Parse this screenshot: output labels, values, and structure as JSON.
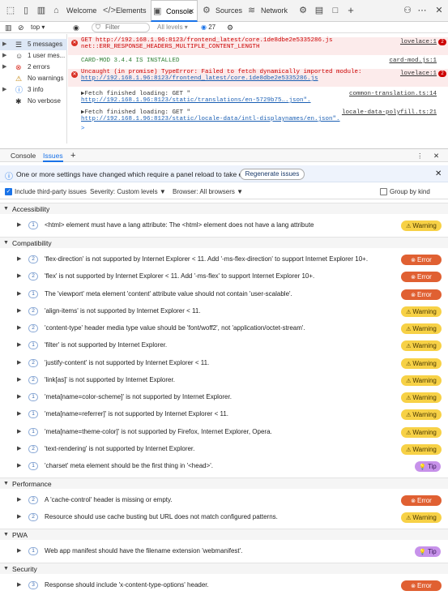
{
  "tabs": {
    "welcome": "Welcome",
    "elements": "Elements",
    "console": "Console",
    "sources": "Sources",
    "network": "Network",
    "new_tab": "+"
  },
  "toolbar": {
    "context": "top",
    "filter_placeholder": "Filter",
    "levels": "All levels",
    "issue_count": "27"
  },
  "sidebar": {
    "items": [
      {
        "label": "5 messages",
        "icon": "list-icon"
      },
      {
        "label": "1 user mes...",
        "icon": "user-icon"
      },
      {
        "label": "2 errors",
        "icon": "error-icon"
      },
      {
        "label": "No warnings",
        "icon": "warning-icon"
      },
      {
        "label": "3 info",
        "icon": "info-icon"
      },
      {
        "label": "No verbose",
        "icon": "verbose-icon"
      }
    ]
  },
  "console": {
    "msg1_line1": "GET http://192.168.1.96:8123/frontend_latest/core.1de8dbe2e5335286.js",
    "msg1_line2": "net::ERR_RESPONSE_HEADERS_MULTIPLE_CONTENT_LENGTH",
    "msg1_src": "lovelace:1",
    "msg2": "CARD-MOD 3.4.4 IS INSTALLED",
    "msg2_src": "card-mod.js:1",
    "msg3_line1": "Uncaught (in promise) TypeError: Failed to fetch dynamically imported module:",
    "msg3_line2": "http://192.168.1.96:8123/frontend_latest/core.1de8dbe2e5335286.js",
    "msg3_src": "lovelace:1",
    "msg4_line1": "▶Fetch finished loading: GET \"",
    "msg4_line2": "http://192.168.1.96:8123/static/translations/en-5729b75….json\".",
    "msg4_src": "common-translation.ts:14",
    "msg5_line1": "▶Fetch finished loading: GET \"",
    "msg5_line2": "http://192.168.1.96:8123/static/locale-data/intl-displaynames/en.json\".",
    "msg5_src": "locale-data-polyfill.ts:21",
    "count": "2",
    "prompt": ">"
  },
  "drawer": {
    "tab_console": "Console",
    "tab_issues": "Issues",
    "add": "+"
  },
  "infobar": {
    "text": "One or more settings have changed which require a panel reload to take effect.",
    "button": "Regenerate issues"
  },
  "options": {
    "third_party": "Include third-party issues",
    "severity": "Severity: Custom levels",
    "browser": "Browser: All browsers",
    "group": "Group by kind"
  },
  "categories": [
    {
      "name": "Accessibility",
      "issues": [
        {
          "count": "1",
          "text": "<html> element must have a lang attribute: The <html> element does not have a lang attribute",
          "severity": "Warning"
        }
      ]
    },
    {
      "name": "Compatibility",
      "issues": [
        {
          "count": "2",
          "text": "'flex-direction' is not supported by Internet Explorer < 11. Add '-ms-flex-direction' to support Internet Explorer 10+.",
          "severity": "Error"
        },
        {
          "count": "2",
          "text": "'flex' is not supported by Internet Explorer < 11. Add '-ms-flex' to support Internet Explorer 10+.",
          "severity": "Error"
        },
        {
          "count": "1",
          "text": "The 'viewport' meta element 'content' attribute value should not contain 'user-scalable'.",
          "severity": "Error"
        },
        {
          "count": "2",
          "text": "'align-items' is not supported by Internet Explorer < 11.",
          "severity": "Warning"
        },
        {
          "count": "2",
          "text": "'content-type' header media type value should be 'font/woff2', not 'application/octet-stream'.",
          "severity": "Warning"
        },
        {
          "count": "1",
          "text": "'filter' is not supported by Internet Explorer.",
          "severity": "Warning"
        },
        {
          "count": "2",
          "text": "'justify-content' is not supported by Internet Explorer < 11.",
          "severity": "Warning"
        },
        {
          "count": "2",
          "text": "'link[as]' is not supported by Internet Explorer.",
          "severity": "Warning"
        },
        {
          "count": "1",
          "text": "'meta[name=color-scheme]' is not supported by Internet Explorer.",
          "severity": "Warning"
        },
        {
          "count": "1",
          "text": "'meta[name=referrer]' is not supported by Internet Explorer < 11.",
          "severity": "Warning"
        },
        {
          "count": "1",
          "text": "'meta[name=theme-color]' is not supported by Firefox, Internet Explorer, Opera.",
          "severity": "Warning"
        },
        {
          "count": "2",
          "text": "'text-rendering' is not supported by Internet Explorer.",
          "severity": "Warning"
        },
        {
          "count": "1",
          "text": "'charset' meta element should be the first thing in '<head>'.",
          "severity": "Tip"
        }
      ]
    },
    {
      "name": "Performance",
      "issues": [
        {
          "count": "2",
          "text": "A 'cache-control' header is missing or empty.",
          "severity": "Error"
        },
        {
          "count": "2",
          "text": "Resource should use cache busting but URL does not match configured patterns.",
          "severity": "Warning"
        }
      ]
    },
    {
      "name": "PWA",
      "issues": [
        {
          "count": "1",
          "text": "Web app manifest should have the filename extension 'webmanifest'.",
          "severity": "Tip"
        }
      ]
    },
    {
      "name": "Security",
      "issues": [
        {
          "count": "3",
          "text": "Response should include 'x-content-type-options' header.",
          "severity": "Error"
        }
      ]
    }
  ]
}
